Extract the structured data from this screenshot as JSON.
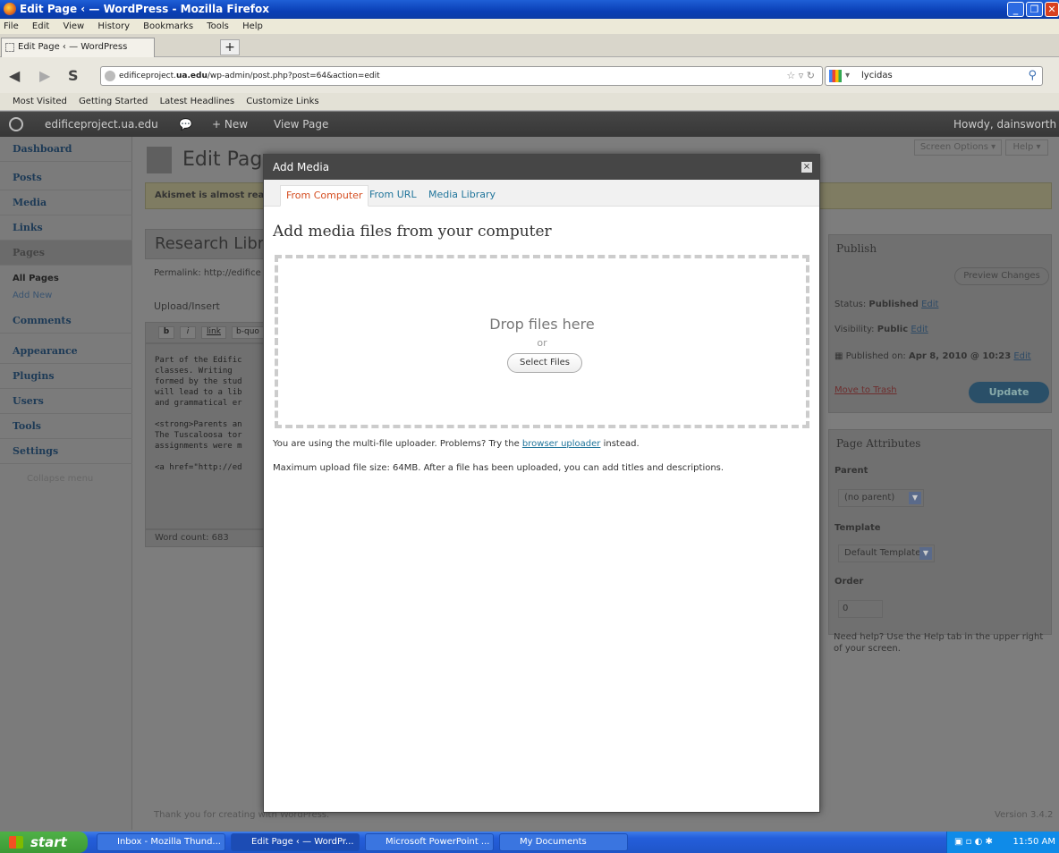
{
  "window": {
    "title": "Edit Page ‹ — WordPress - Mozilla Firefox"
  },
  "menubar": [
    "File",
    "Edit",
    "View",
    "History",
    "Bookmarks",
    "Tools",
    "Help"
  ],
  "tab": {
    "label": "Edit Page ‹ — WordPress",
    "new_tab": "+"
  },
  "url": {
    "prefix": "edificeproject.",
    "domain": "ua.edu",
    "path": "/wp-admin/post.php?post=64&action=edit"
  },
  "search": {
    "value": "lycidas"
  },
  "bookmarks": [
    "Most Visited",
    "Getting Started",
    "Latest Headlines",
    "Customize Links"
  ],
  "adminbar": {
    "site": "edificeproject.ua.edu",
    "new": "+ New",
    "view": "View Page",
    "howdy": "Howdy, dainsworth"
  },
  "sidebar": {
    "dashboard": "Dashboard",
    "posts": "Posts",
    "media": "Media",
    "links": "Links",
    "pages": "Pages",
    "all_pages": "All Pages",
    "add_new": "Add New",
    "comments": "Comments",
    "appearance": "Appearance",
    "plugins": "Plugins",
    "users": "Users",
    "tools": "Tools",
    "settings": "Settings",
    "collapse": "Collapse menu"
  },
  "page": {
    "heading": "Edit Page",
    "akismet": "Akismet is almost read",
    "title_value": "Research Libra",
    "permalink": "Permalink: http://edifice",
    "upload_insert": "Upload/Insert",
    "editor_buttons": [
      "b",
      "i",
      "link",
      "b-quo"
    ],
    "content_lines": [
      "Part of the Edific",
      "classes.  Writing",
      "formed by the stud",
      "will lead to a lib",
      "and grammatical er",
      "",
      "<strong>Parents an",
      "The Tuscaloosa tor",
      "assignments were m",
      "",
      "<a href=\"http://ed"
    ],
    "word_count": "Word count: 683",
    "footer_left": "Thank you for creating with WordPress.",
    "footer_right": "Version 3.4.2",
    "screen_options": "Screen Options ▾",
    "help": "Help ▾"
  },
  "publish": {
    "title": "Publish",
    "preview": "Preview Changes",
    "status_label": "Status:",
    "status": "Published",
    "status_edit": "Edit",
    "visibility_label": "Visibility:",
    "visibility": "Public",
    "visibility_edit": "Edit",
    "published_label": "Published on:",
    "published_on": "Apr 8, 2010 @ 10:23",
    "published_edit": "Edit",
    "trash": "Move to Trash",
    "update": "Update"
  },
  "attributes": {
    "title": "Page Attributes",
    "parent_label": "Parent",
    "parent_value": "(no parent)",
    "template_label": "Template",
    "template_value": "Default Template",
    "order_label": "Order",
    "order_value": "0",
    "help_text": "Need help? Use the Help tab in the upper right of your screen."
  },
  "modal": {
    "title": "Add Media",
    "close": "×",
    "tabs": [
      "From Computer",
      "From URL",
      "Media Library"
    ],
    "heading": "Add media files from your computer",
    "drop": "Drop files here",
    "or": "or",
    "select": "Select Files",
    "multi_prefix": "You are using the multi-file uploader. Problems? Try the ",
    "multi_link": "browser uploader",
    "multi_suffix": " instead.",
    "max": "Maximum upload file size: 64MB. After a file has been uploaded, you can add titles and descriptions."
  },
  "taskbar": {
    "start": "start",
    "tasks": [
      "Inbox - Mozilla Thund...",
      "Edit Page ‹ — WordPr...",
      "Microsoft PowerPoint ...",
      "My Documents"
    ],
    "clock": "11:50 AM"
  }
}
